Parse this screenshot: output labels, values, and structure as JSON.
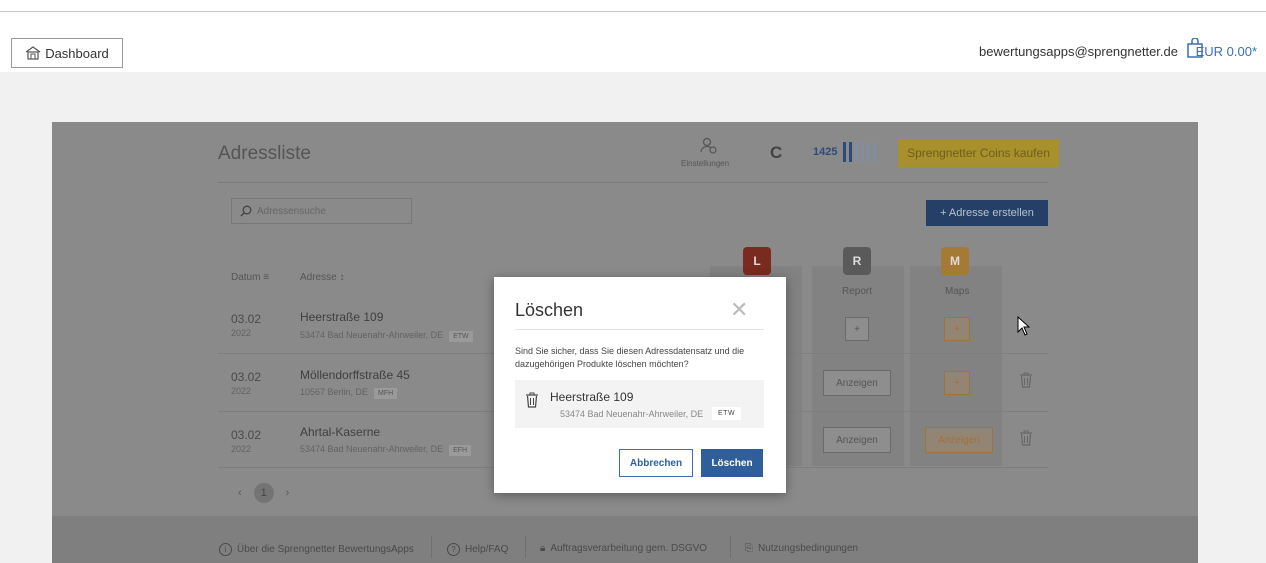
{
  "header": {
    "dashboard_label": "Dashboard",
    "email": "bewertungsapps@sprengnetter.de",
    "cart_amount": "EUR 0.00*"
  },
  "app": {
    "title": "Adressliste",
    "settings_label": "Einstellungen",
    "coin_symbol": "C",
    "coin_count": "1425",
    "coin_level_bars": {
      "filled": 2,
      "total": 6
    },
    "buy_coins_label": "Sprengnetter Coins kaufen",
    "search_placeholder": "Adressensuche",
    "add_address_label": "+ Adresse erstellen",
    "columns": {
      "date": "Datum",
      "address": "Adresse",
      "report": "Report",
      "maps": "Maps"
    },
    "product_icons": {
      "first": "L",
      "report": "R",
      "maps": "M"
    },
    "rows": [
      {
        "day": "03.02",
        "year": "2022",
        "street": "Heerstraße 109",
        "city": "53474 Bad Neuenahr-Ahrweiler, DE",
        "tag": "ETW",
        "report_action": "+",
        "maps_action": "+"
      },
      {
        "day": "03.02",
        "year": "2022",
        "street": "Möllendorffstraße 45",
        "city": "10567 Berlin, DE",
        "tag": "MFH",
        "report_action": "Anzeigen",
        "maps_action": "+"
      },
      {
        "day": "03.02",
        "year": "2022",
        "street": "Ahrtal-Kaserne",
        "city": "53474 Bad Neuenahr-Ahrweiler, DE",
        "tag": "EFH",
        "report_action": "Anzeigen",
        "maps_action": "Anzeigen"
      }
    ],
    "pager": {
      "prev": "‹",
      "current": "1",
      "next": "›"
    },
    "footer": [
      "Über die Sprengnetter BewertungsApps",
      "Help/FAQ",
      "Auftragsverarbeitung gem. DSGVO",
      "Nutzungsbedingungen"
    ]
  },
  "modal": {
    "title": "Löschen",
    "close": "✕",
    "question": "Sind Sie sicher, dass Sie diesen Adressdatensatz und die dazugehörigen Produkte löschen möchten?",
    "street": "Heerstraße 109",
    "city": "53474 Bad Neuenahr-Ahrweiler, DE",
    "tag": "ETW",
    "cancel_label": "Abbrechen",
    "delete_label": "Löschen"
  },
  "colors": {
    "accent_blue": "#3a6fb7",
    "primary_button": "#2f5f9a",
    "coins_yellow": "#f5c842"
  }
}
